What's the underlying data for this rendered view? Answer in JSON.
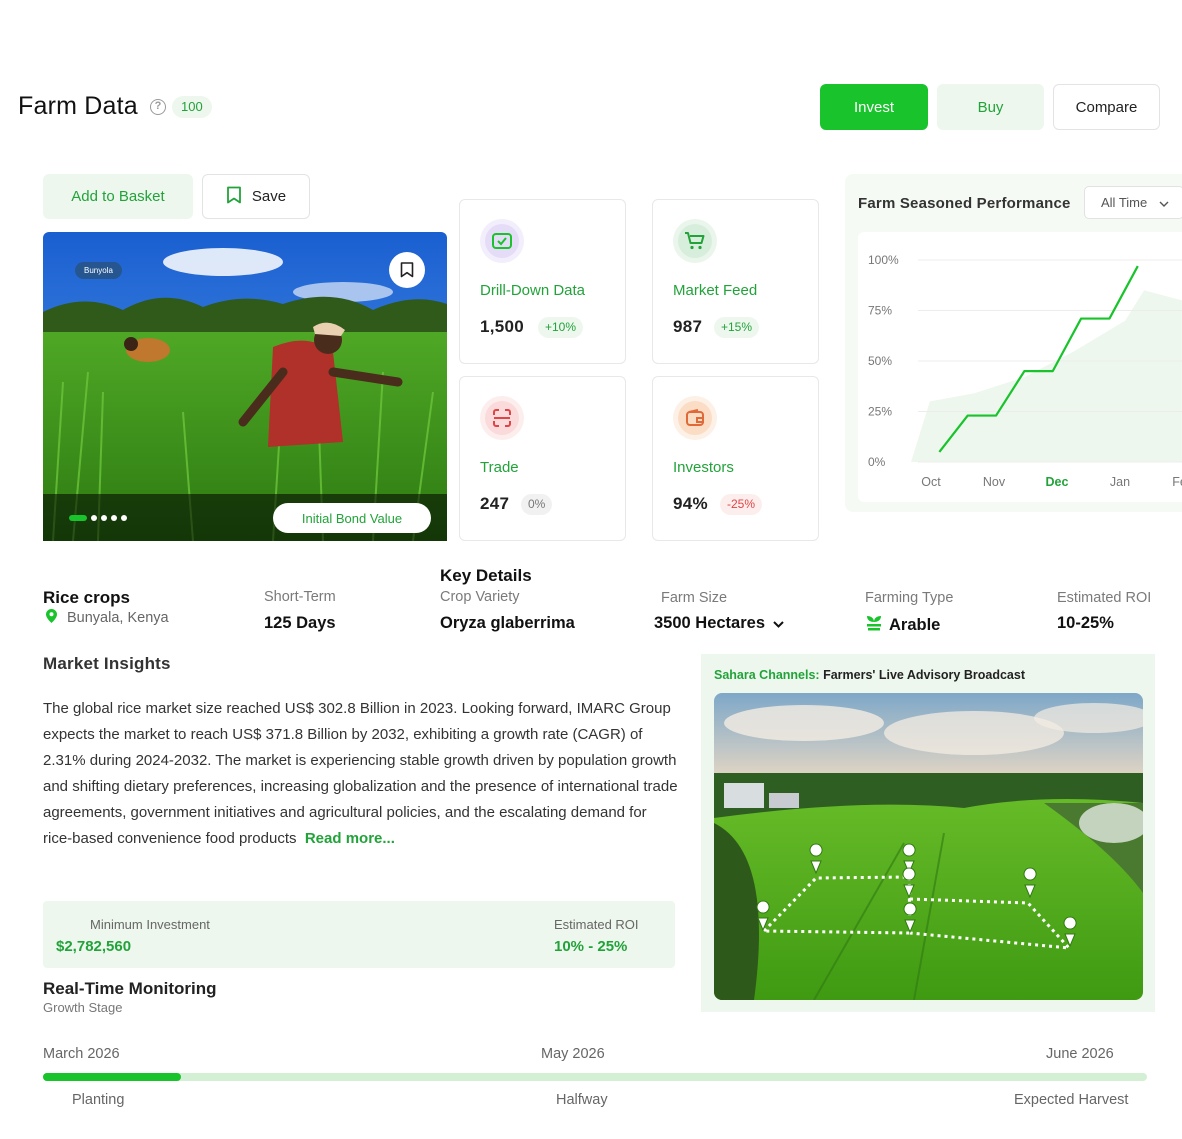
{
  "header": {
    "title": "Farm Data",
    "count": "100",
    "invest_label": "Invest",
    "buy_label": "Buy",
    "compare_label": "Compare"
  },
  "actions": {
    "basket_label": "Add to Basket",
    "save_label": "Save"
  },
  "hero": {
    "tag": "Bunyola",
    "bond_label": "Initial Bond Value",
    "slides": 5,
    "active_slide": 1
  },
  "stats": [
    {
      "label": "Drill-Down Data",
      "value": "1,500",
      "change": "+10%",
      "icon": "screen-check-icon"
    },
    {
      "label": "Market Feed",
      "value": "987",
      "change": "+15%",
      "icon": "cart-icon"
    },
    {
      "label": "Trade",
      "value": "247",
      "change": "0%",
      "icon": "scan-icon"
    },
    {
      "label": "Investors",
      "value": "94%",
      "change": "-25%",
      "icon": "wallet-icon"
    }
  ],
  "performance": {
    "title": "Farm Seasoned Performance",
    "filter": "All Time"
  },
  "chart_data": {
    "type": "line",
    "x": [
      "Oct",
      "Nov",
      "Dec",
      "Jan",
      "Feb"
    ],
    "highlight_tick": "Dec",
    "y_ticks": [
      "100%",
      "75%",
      "50%",
      "25%",
      "0%"
    ],
    "ylim": [
      0,
      100
    ],
    "series": [
      {
        "points": [
          [
            0.15,
            5
          ],
          [
            0.6,
            23
          ],
          [
            1.05,
            23
          ],
          [
            1.5,
            45
          ],
          [
            1.95,
            45
          ],
          [
            2.4,
            71
          ],
          [
            2.85,
            71
          ],
          [
            3.3,
            97
          ]
        ],
        "color": "#19c32b"
      }
    ],
    "background_area": [
      [
        0,
        0
      ],
      [
        0.3,
        30
      ],
      [
        1.0,
        34
      ],
      [
        1.8,
        42
      ],
      [
        2.6,
        55
      ],
      [
        3.4,
        70
      ],
      [
        3.7,
        85
      ],
      [
        4.3,
        80
      ],
      [
        4.3,
        0
      ]
    ]
  },
  "details": {
    "crop_title": "Rice crops",
    "location": "Bunyala, Kenya",
    "key_title": "Key Details",
    "items": [
      {
        "label": "Short-Term",
        "value": "125 Days"
      },
      {
        "label": "Crop Variety",
        "value": "Oryza glaberrima"
      },
      {
        "label": "Farm Size",
        "value": "3500 Hectares"
      },
      {
        "label": "Farming Type",
        "value": "Arable"
      },
      {
        "label": "Estimated ROI",
        "value": "10-25%"
      }
    ]
  },
  "insights": {
    "title": "Market Insights",
    "text": "The global rice market size reached US$ 302.8 Billion in 2023. Looking forward, IMARC Group expects the market to reach US$ 371.8 Billion by 2032, exhibiting a growth rate (CAGR) of 2.31% during 2024-2032. The market is experiencing stable growth driven by population growth and shifting dietary preferences, increasing globalization and the presence of international trade agreements, government initiatives and agricultural policies, and the escalating demand for rice-based convenience food products",
    "read_more": "Read more..."
  },
  "investment": {
    "min_label": "Minimum Investment",
    "min_value": "$2,782,560",
    "roi_label": "Estimated ROI",
    "roi_value": "10% - 25%"
  },
  "broadcast": {
    "brand": "Sahara Channels:",
    "title": "Farmers' Live Advisory Broadcast"
  },
  "monitoring": {
    "title": "Real-Time Monitoring",
    "subtitle": "Growth Stage",
    "dates": [
      "March 2026",
      "May 2026",
      "June 2026"
    ],
    "stages": [
      "Planting",
      "Halfway",
      "Expected Harvest"
    ],
    "progress": 0.125
  },
  "colors": {
    "accent": "#19c32b",
    "accent_text": "#22a33a",
    "accent_bg": "#eef7ee",
    "negative": "#e04545"
  }
}
